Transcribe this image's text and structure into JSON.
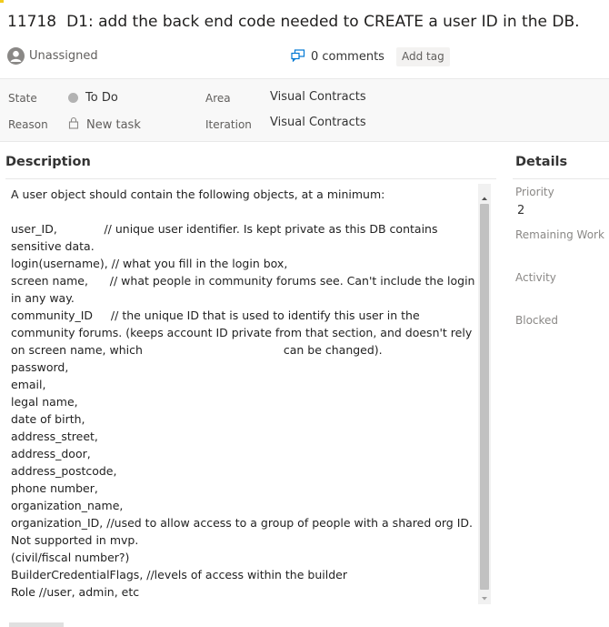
{
  "work_item": {
    "id": "11718",
    "title": "D1: add the back end code needed to CREATE a user ID in the DB.",
    "assignee": "Unassigned",
    "comments_label": "0 comments",
    "add_tag_label": "Add tag",
    "accent_color": "#f2cb1d"
  },
  "fields": {
    "state": {
      "label": "State",
      "value": "To Do",
      "dot_color": "#b2b2b2"
    },
    "reason": {
      "label": "Reason",
      "value": "New task"
    },
    "area": {
      "label": "Area",
      "value": "Visual Contracts"
    },
    "iteration": {
      "label": "Iteration",
      "value": "Visual Contracts"
    }
  },
  "description": {
    "heading": "Description",
    "text": "A user object should contain the following objects, at a minimum:\n\nuser_ID,             // unique user identifier. Is kept private as this DB contains sensitive data.\nlogin(username), // what you fill in the login box,\nscreen name,      // what people in community forums see. Can't include the login in any way.\ncommunity_ID     // the unique ID that is used to identify this user in the community forums. (keeps account ID private from that section, and doesn't rely on screen name, which                                       can be changed).\npassword,\nemail,\nlegal name,\ndate of birth,\naddress_street,\naddress_door,\naddress_postcode,\nphone number,\norganization_name,\norganization_ID, //used to allow access to a group of people with a shared org ID. Not supported in mvp.\n(civil/fiscal number?)\nBuilderCredentialFlags, //levels of access within the builder\nRole //user, admin, etc"
  },
  "details": {
    "heading": "Details",
    "priority_label": "Priority",
    "priority_value": "2",
    "remaining_work_label": "Remaining Work",
    "activity_label": "Activity",
    "blocked_label": "Blocked"
  },
  "icons": {
    "assignee": "user-avatar-icon",
    "comments": "comment-bubble-icon",
    "reason": "lock-icon",
    "scroll_up": "scroll-up-arrow-icon",
    "scroll_down": "scroll-down-arrow-icon"
  }
}
